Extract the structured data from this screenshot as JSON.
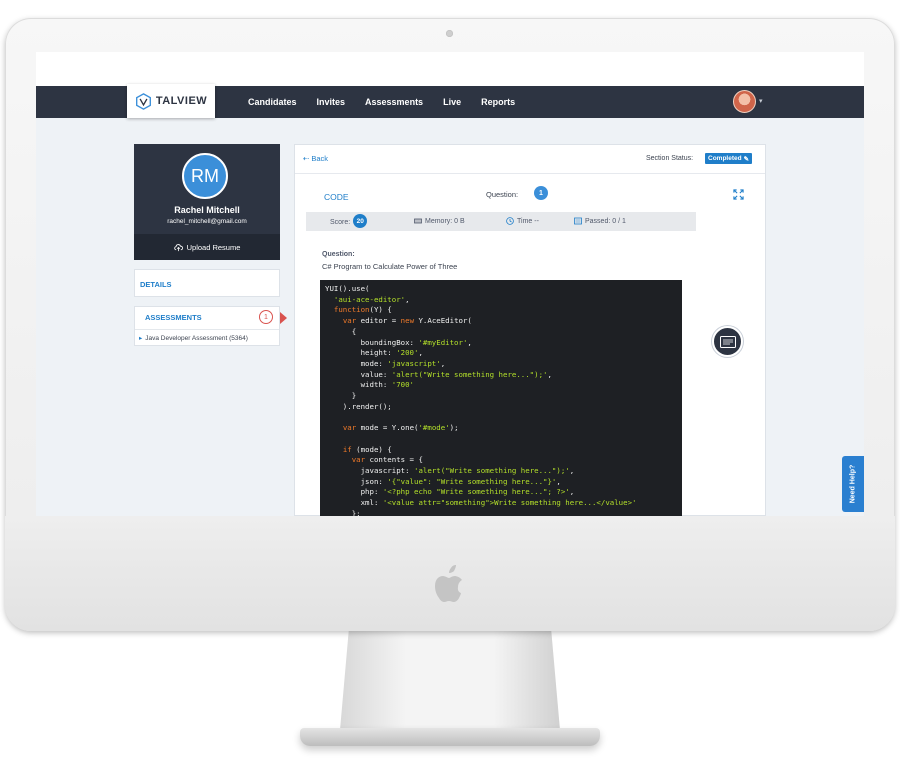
{
  "brand": {
    "name": "TALVIEW",
    "accent": "#2d3442",
    "primary": "#1f7ec9",
    "alert": "#d9534f"
  },
  "nav": {
    "items": [
      "Candidates",
      "Invites",
      "Assessments",
      "Live",
      "Reports"
    ],
    "caret": "▾"
  },
  "profile": {
    "initials": "RM",
    "name": "Rachel Mitchell",
    "email": "rachel_mitchell@gmail.com",
    "upload_label": "Upload Resume"
  },
  "sidebar": {
    "details_label": "DETAILS",
    "assessments_label": "ASSESSMENTS",
    "assessments_count": "1",
    "assessment_item": "Java Developer Assessment (5364)"
  },
  "main": {
    "back_label": "Back",
    "section_status_label": "Section Status:",
    "section_status_value": "Completed",
    "code_tab": "CODE",
    "question_label": "Question:",
    "question_number": "1",
    "stats": {
      "score_label": "Score:",
      "score_value": "20",
      "memory": "Memory: 0 B",
      "time": "Time --",
      "passed": "Passed: 0 / 1"
    },
    "question_heading": "Question:",
    "question_text": "C# Program to Calculate Power of Three",
    "code_lines": [
      [
        [
          "t",
          "YUI().use("
        ]
      ],
      [
        [
          "t",
          "  "
        ],
        [
          "s",
          "'aui-ace-editor'"
        ],
        [
          "t",
          ","
        ]
      ],
      [
        [
          "t",
          "  "
        ],
        [
          "k",
          "function"
        ],
        [
          "t",
          "(Y) {"
        ]
      ],
      [
        [
          "t",
          "    "
        ],
        [
          "k",
          "var"
        ],
        [
          "t",
          " editor = "
        ],
        [
          "k",
          "new"
        ],
        [
          "t",
          " Y.AceEditor("
        ]
      ],
      [
        [
          "t",
          "      {"
        ]
      ],
      [
        [
          "t",
          "        boundingBox: "
        ],
        [
          "s",
          "'#myEditor'"
        ],
        [
          "t",
          ","
        ]
      ],
      [
        [
          "t",
          "        height: "
        ],
        [
          "s",
          "'200'"
        ],
        [
          "t",
          ","
        ]
      ],
      [
        [
          "t",
          "        mode: "
        ],
        [
          "s",
          "'javascript'"
        ],
        [
          "t",
          ","
        ]
      ],
      [
        [
          "t",
          "        value: "
        ],
        [
          "s",
          "'alert(\"Write something here...\");'"
        ],
        [
          "t",
          ","
        ]
      ],
      [
        [
          "t",
          "        width: "
        ],
        [
          "s",
          "'700'"
        ]
      ],
      [
        [
          "t",
          "      }"
        ]
      ],
      [
        [
          "t",
          "    ).render();"
        ]
      ],
      [
        [
          "t",
          ""
        ]
      ],
      [
        [
          "t",
          "    "
        ],
        [
          "k",
          "var"
        ],
        [
          "t",
          " mode = Y.one("
        ],
        [
          "s",
          "'#mode'"
        ],
        [
          "t",
          ");"
        ]
      ],
      [
        [
          "t",
          ""
        ]
      ],
      [
        [
          "t",
          "    "
        ],
        [
          "k",
          "if"
        ],
        [
          "t",
          " (mode) {"
        ]
      ],
      [
        [
          "t",
          "      "
        ],
        [
          "k",
          "var"
        ],
        [
          "t",
          " contents = {"
        ]
      ],
      [
        [
          "t",
          "        javascript: "
        ],
        [
          "s",
          "'alert(\"Write something here...\");'"
        ],
        [
          "t",
          ","
        ]
      ],
      [
        [
          "t",
          "        json: "
        ],
        [
          "s",
          "'{\"value\": \"Write something here...\"}'"
        ],
        [
          "t",
          ","
        ]
      ],
      [
        [
          "t",
          "        php: "
        ],
        [
          "s",
          "'<?php echo \"Write something here...\"; ?>'"
        ],
        [
          "t",
          ","
        ]
      ],
      [
        [
          "t",
          "        xml: "
        ],
        [
          "s",
          "'<value attr=\"something\">Write something here...</value>'"
        ]
      ],
      [
        [
          "t",
          "      };"
        ]
      ]
    ]
  },
  "help": {
    "label": "Need Help?"
  },
  "icons": {
    "logo": "talview-logo-icon",
    "upload": "upload-cloud-icon",
    "back": "arrow-left-icon",
    "edit": "pencil-icon",
    "expand": "expand-icon",
    "memory": "memory-icon",
    "time": "clock-icon",
    "passed": "test-case-icon",
    "chat": "chat-panel-icon",
    "apple": "apple-logo-icon"
  }
}
